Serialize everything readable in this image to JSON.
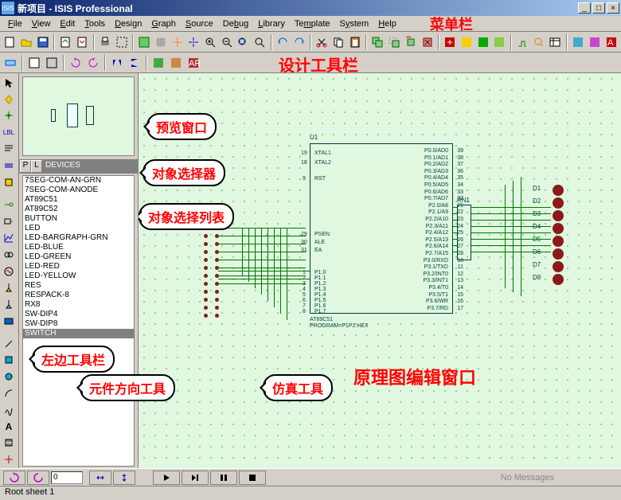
{
  "window": {
    "title": "新项目 - ISIS Professional",
    "icon_text": "ISIS"
  },
  "menu": {
    "items": [
      "File",
      "View",
      "Edit",
      "Tools",
      "Design",
      "Graph",
      "Source",
      "Debug",
      "Library",
      "Template",
      "System",
      "Help"
    ],
    "label": "菜单栏"
  },
  "toolbar2_label": "设计工具栏",
  "devices": {
    "header": "DEVICES",
    "btnP": "P",
    "btnL": "L",
    "list": [
      "7SEG-COM-AN-GRN",
      "7SEG-COM-ANODE",
      "AT89C51",
      "AT89C52",
      "BUTTON",
      "LED",
      "LED-BARGRAPH-GRN",
      "LED-BLUE",
      "LED-GREEN",
      "LED-RED",
      "LED-YELLOW",
      "RES",
      "RESPACK-8",
      "RX8",
      "SW-DIP4",
      "SW-DIP8",
      "SWITCH"
    ],
    "selected": "SWITCH"
  },
  "callouts": {
    "preview": "预览窗口",
    "selector": "对象选择器",
    "list": "对象选择列表",
    "leftbar": "左边工具栏",
    "orient": "元件方向工具",
    "sim": "仿真工具",
    "schematic": "原理图编辑窗口"
  },
  "schematic": {
    "u1": "U1",
    "u1_name": "AT89C51",
    "u1_prog": "PROGRAM=P1P2.HEX",
    "rn1": "RN1",
    "d_labels": [
      "D1",
      "D2",
      "D3",
      "D4",
      "D5",
      "D6",
      "D7",
      "D8"
    ],
    "pins_left_upper": [
      "XTAL1",
      "XTAL2",
      "RST",
      "PSEN",
      "ALE",
      "EA"
    ],
    "pins_left_nums_upper": [
      "19",
      "18",
      "9",
      "29",
      "30",
      "31"
    ],
    "pins_left_lower": [
      "P1.0",
      "P1.1",
      "P1.2",
      "P1.3",
      "P1.4",
      "P1.5",
      "P1.6",
      "P1.7"
    ],
    "pins_left_nums_lower": [
      "1",
      "2",
      "3",
      "4",
      "5",
      "6",
      "7",
      "8"
    ],
    "pins_right": [
      "P0.0/AD0",
      "P0.1/AD1",
      "P0.2/AD2",
      "P0.3/AD3",
      "P0.4/AD4",
      "P0.5/AD5",
      "P0.6/AD6",
      "P0.7/AD7",
      "P2.0/A8",
      "P2.1/A9",
      "P2.2/A10",
      "P2.3/A11",
      "P2.4/A12",
      "P2.5/A13",
      "P2.6/A14",
      "P2.7/A15",
      "P3.0/RXD",
      "P3.1/TXD",
      "P3.2/INT0",
      "P3.3/INT1",
      "P3.4/T0",
      "P3.5/T1",
      "P3.6/WR",
      "P3.7/RD"
    ],
    "pins_right_nums": [
      "39",
      "38",
      "37",
      "36",
      "35",
      "34",
      "33",
      "32",
      "21",
      "22",
      "23",
      "24",
      "25",
      "26",
      "27",
      "28",
      "10",
      "11",
      "12",
      "13",
      "14",
      "15",
      "16",
      "17"
    ]
  },
  "bottom": {
    "angle": "0",
    "messages": "No Messages",
    "sheet": "Root sheet 1"
  }
}
